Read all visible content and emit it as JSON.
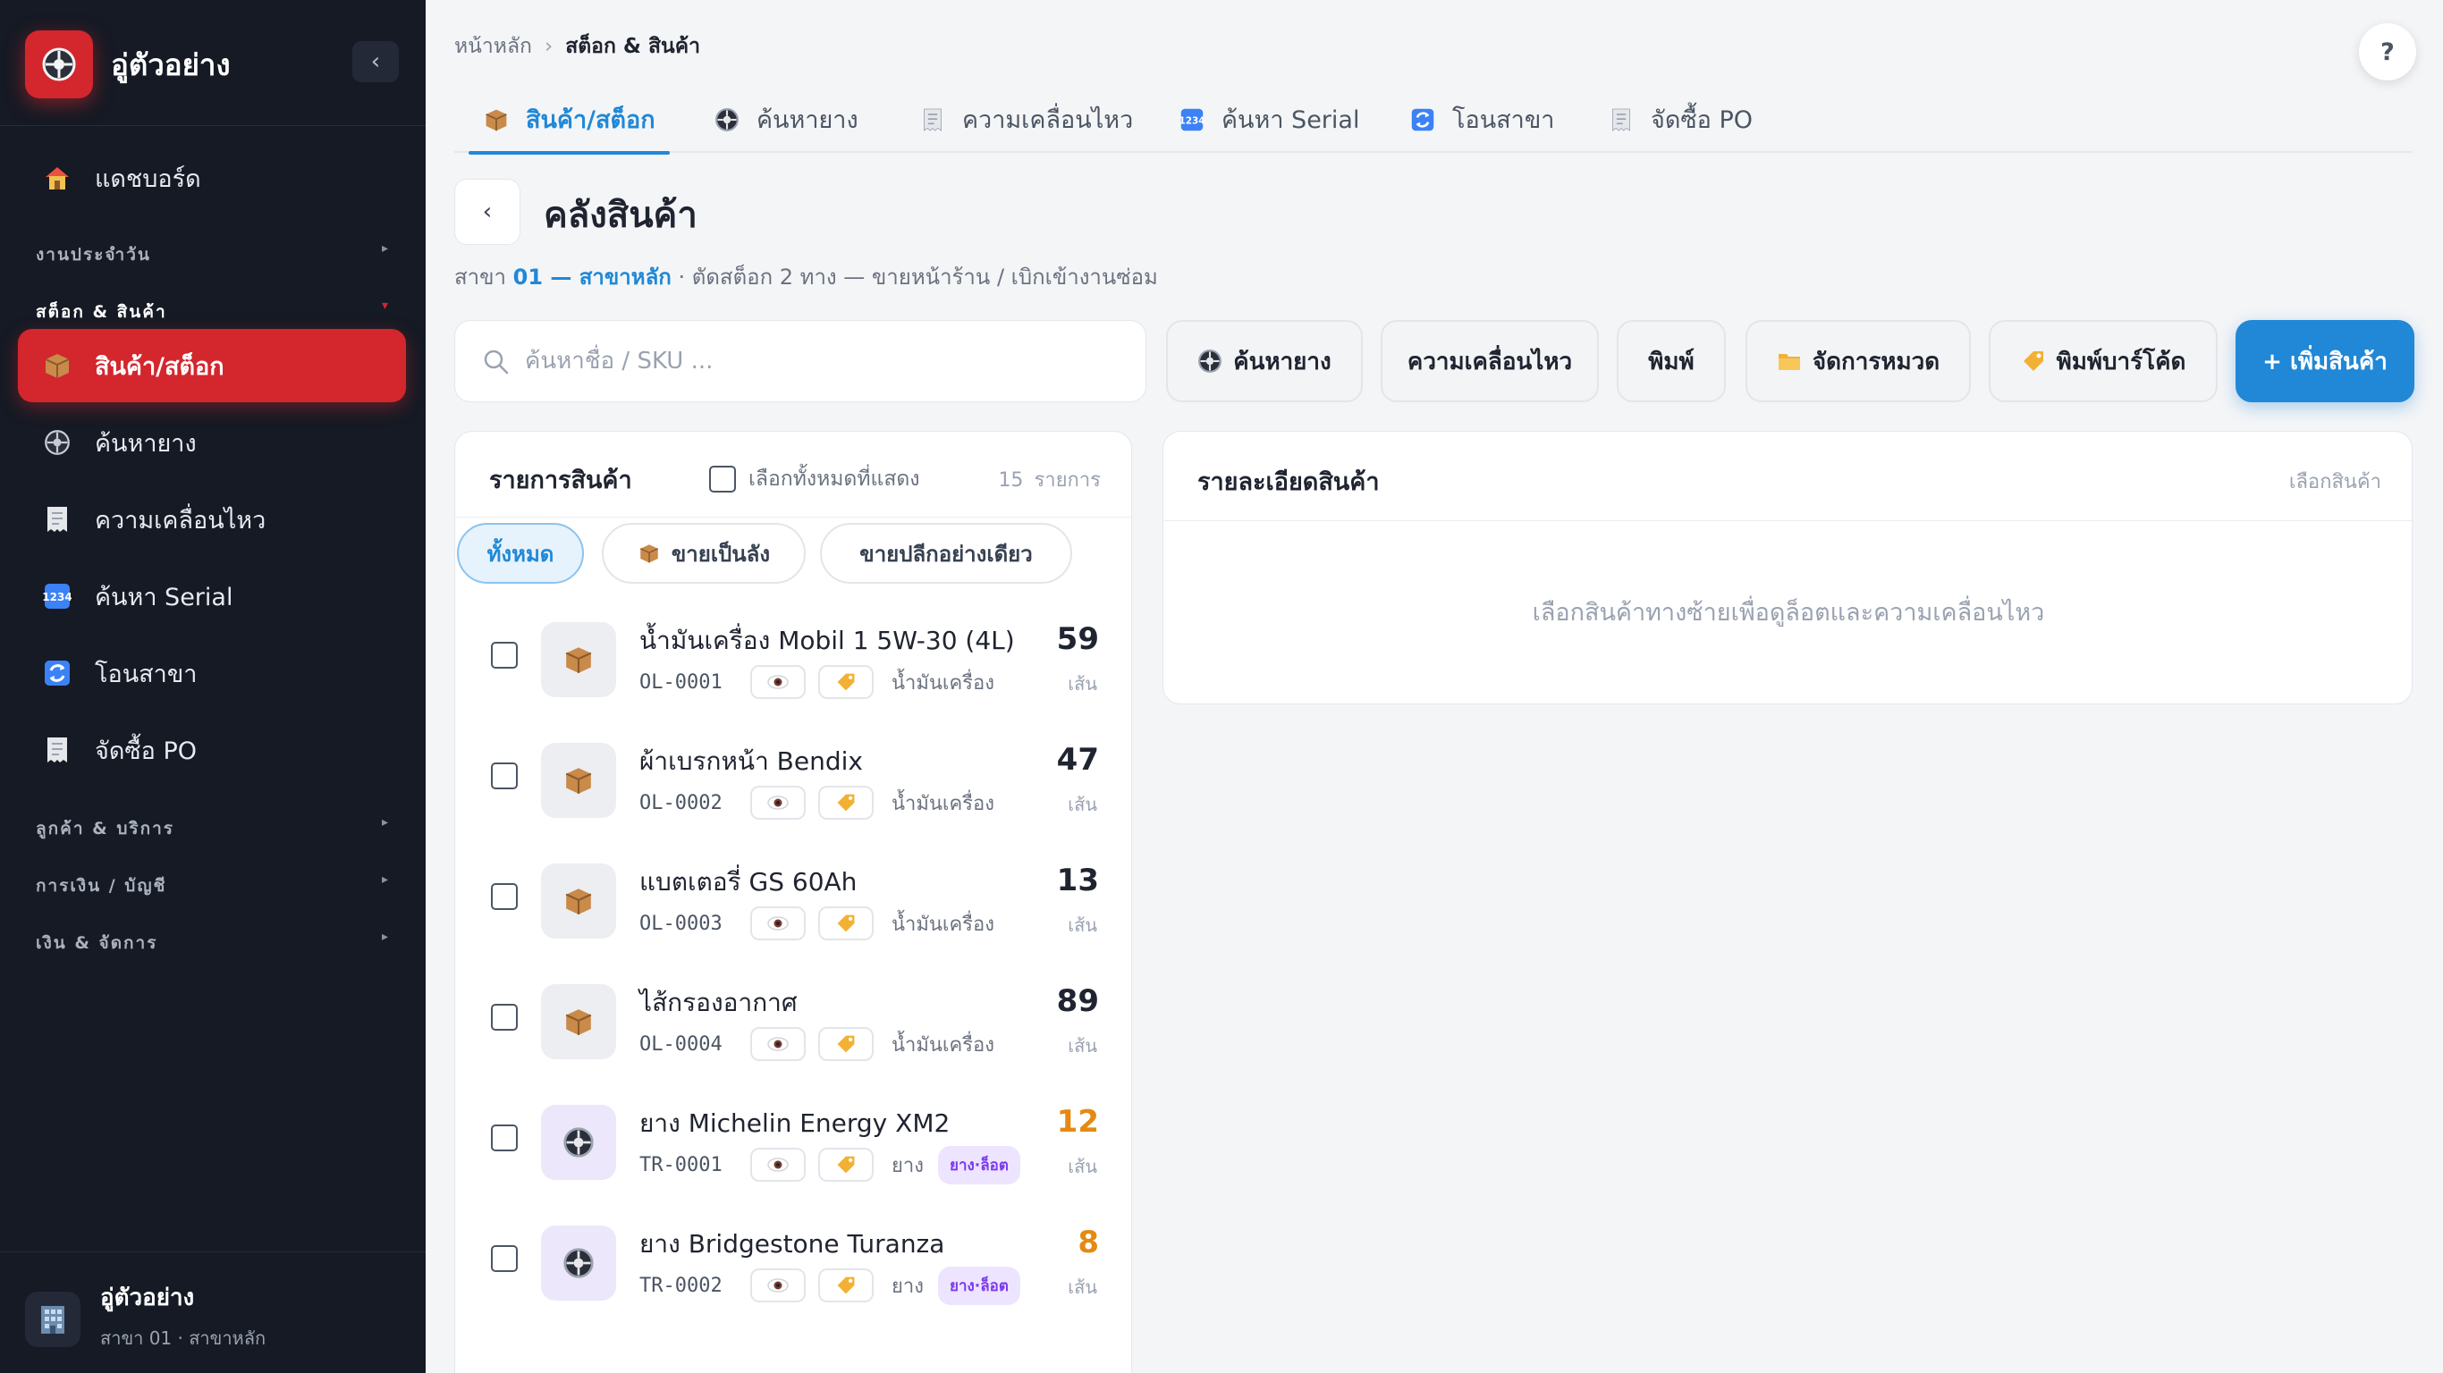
{
  "app": {
    "title": "อู่ตัวอย่าง",
    "collapse_icon": "‹"
  },
  "sidebar": {
    "dashboard": "แดชบอร์ด",
    "sections": {
      "daily": "งานประจำวัน",
      "stock": "สต็อก & สินค้า",
      "customers": "ลูกค้า & บริการ",
      "finance": "การเงิน / บัญชี",
      "manage": "เงิน & จัดการ"
    },
    "items": [
      {
        "label": "สินค้า/สต็อก",
        "icon": "box-icon"
      },
      {
        "label": "ค้นหายาง",
        "icon": "tire-icon"
      },
      {
        "label": "ความเคลื่อนไหว",
        "icon": "receipt-icon"
      },
      {
        "label": "ค้นหา Serial",
        "icon": "numbers-icon"
      },
      {
        "label": "โอนสาขา",
        "icon": "transfer-icon"
      },
      {
        "label": "จัดซื้อ PO",
        "icon": "receipt-icon"
      }
    ],
    "footer": {
      "user": "อู่ตัวอย่าง",
      "branch": "สาขา 01 · สาขาหลัก"
    }
  },
  "breadcrumb": {
    "home": "หน้าหลัก",
    "sep": "›",
    "current": "สต็อก & สินค้า"
  },
  "help_label": "?",
  "tabs": [
    {
      "label": "สินค้า/สต็อก",
      "icon": "box-icon"
    },
    {
      "label": "ค้นหายาง",
      "icon": "tire-icon"
    },
    {
      "label": "ความเคลื่อนไหว",
      "icon": "receipt-icon"
    },
    {
      "label": "ค้นหา Serial",
      "icon": "numbers-icon"
    },
    {
      "label": "โอนสาขา",
      "icon": "transfer-icon"
    },
    {
      "label": "จัดซื้อ PO",
      "icon": "receipt-icon"
    }
  ],
  "page": {
    "back_icon": "‹",
    "title": "คลังสินค้า",
    "subtitle_prefix": "สาขา",
    "subtitle_branch": "01 — สาขาหลัก",
    "subtitle_rest": "· ตัดสต็อก 2 ทาง — ขายหน้าร้าน / เบิกเข้างานซ่อม"
  },
  "search": {
    "placeholder": "ค้นหาชื่อ / SKU ..."
  },
  "toolbar": {
    "tire_search": "ค้นหายาง",
    "movement": "ความเคลื่อนไหว",
    "print": "พิมพ์",
    "categories": "จัดการหมวด",
    "barcode": "พิมพ์บาร์โค้ด",
    "add": "+ เพิ่มสินค้า"
  },
  "list": {
    "title": "รายการสินค้า",
    "select_all": "เลือกทั้งหมดที่แสดง",
    "count": "15",
    "count_unit": "รายการ",
    "filters": {
      "all": "ทั้งหมด",
      "wholesale": "ขายเป็นลัง",
      "retail": "ขายปลีกอย่างเดียว"
    },
    "items": [
      {
        "name": "น้ำมันเครื่อง Mobil 1 5W-30 (4L)",
        "sku": "OL-0001",
        "category": "น้ำมันเครื่อง",
        "qty": "59",
        "unit": "เส้น",
        "kind": "box",
        "low": false,
        "tag": ""
      },
      {
        "name": "ผ้าเบรกหน้า Bendix",
        "sku": "OL-0002",
        "category": "น้ำมันเครื่อง",
        "qty": "47",
        "unit": "เส้น",
        "kind": "box",
        "low": false,
        "tag": ""
      },
      {
        "name": "แบตเตอรี่ GS 60Ah",
        "sku": "OL-0003",
        "category": "น้ำมันเครื่อง",
        "qty": "13",
        "unit": "เส้น",
        "kind": "box",
        "low": false,
        "tag": ""
      },
      {
        "name": "ไส้กรองอากาศ",
        "sku": "OL-0004",
        "category": "น้ำมันเครื่อง",
        "qty": "89",
        "unit": "เส้น",
        "kind": "box",
        "low": false,
        "tag": ""
      },
      {
        "name": "ยาง Michelin Energy XM2",
        "sku": "TR-0001",
        "category": "ยาง",
        "qty": "12",
        "unit": "เส้น",
        "kind": "tire",
        "low": true,
        "tag": "ยาง·ล็อต"
      },
      {
        "name": "ยาง Bridgestone Turanza",
        "sku": "TR-0002",
        "category": "ยาง",
        "qty": "8",
        "unit": "เส้น",
        "kind": "tire",
        "low": true,
        "tag": "ยาง·ล็อต"
      }
    ]
  },
  "detail": {
    "title": "รายละเอียดสินค้า",
    "hint": "เลือกสินค้า",
    "empty": "เลือกสินค้าทางซ้ายเพื่อดูล็อตและความเคลื่อนไหว"
  },
  "colors": {
    "brand_red": "#d4262d",
    "accent_blue": "#2088d6",
    "low_stock": "#e48a12",
    "tag_purple": "#7c3aed",
    "sidebar_bg": "#151a24"
  }
}
